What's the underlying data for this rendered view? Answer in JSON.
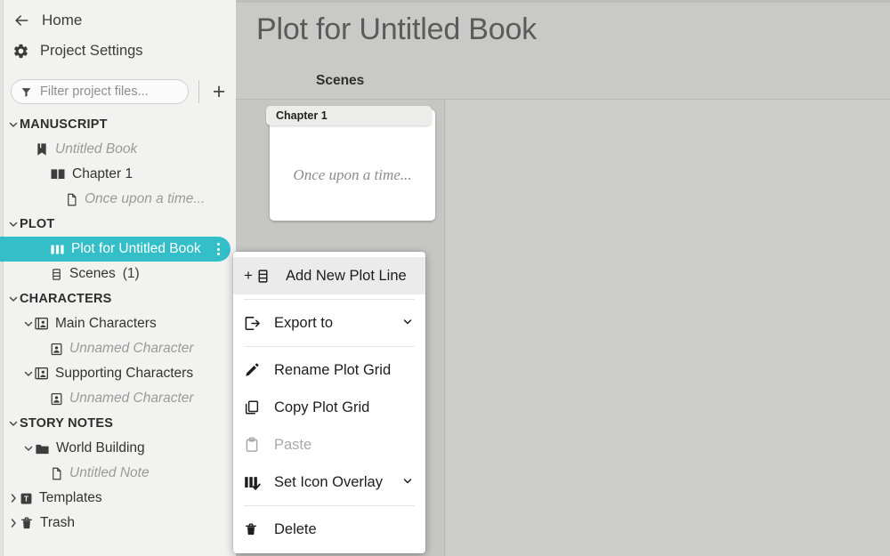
{
  "sidebar": {
    "home_label": "Home",
    "home_icon": "back-arrow-icon",
    "settings_label": "Project Settings",
    "settings_icon": "gear-icon",
    "filter_placeholder": "Filter project files...",
    "filter_value": "",
    "filter_icon": "funnel-icon",
    "add_label": "+",
    "tree": [
      {
        "label": "MANUSCRIPT",
        "type": "group",
        "indent": 0,
        "chevron": "down",
        "icon": null
      },
      {
        "label": "Untitled Book",
        "type": "item-muted",
        "indent": 1,
        "chevron": null,
        "icon": "book-bookmark-icon"
      },
      {
        "label": "Chapter 1",
        "type": "item",
        "indent": 2,
        "chevron": null,
        "icon": "open-book-icon"
      },
      {
        "label": "Once upon a time...",
        "type": "item-muted",
        "indent": 3,
        "chevron": null,
        "icon": "document-icon"
      },
      {
        "label": "PLOT",
        "type": "group",
        "indent": 0,
        "chevron": "down",
        "icon": null
      },
      {
        "label": "Plot for Untitled Book",
        "type": "item-selected",
        "indent": 2,
        "chevron": null,
        "icon": "plot-grid-icon"
      },
      {
        "label": "Scenes",
        "type": "item",
        "indent": 2,
        "chevron": null,
        "icon": "scenes-icon",
        "count": "(1)"
      },
      {
        "label": "CHARACTERS",
        "type": "group",
        "indent": 0,
        "chevron": "down",
        "icon": null
      },
      {
        "label": "Main Characters",
        "type": "item",
        "indent": 1,
        "chevron": "down",
        "icon": "character-stack-icon"
      },
      {
        "label": "Unnamed Character",
        "type": "item-muted",
        "indent": 2,
        "chevron": null,
        "icon": "character-icon"
      },
      {
        "label": "Supporting Characters",
        "type": "item",
        "indent": 1,
        "chevron": "down",
        "icon": "character-stack-icon"
      },
      {
        "label": "Unnamed Character",
        "type": "item-muted",
        "indent": 2,
        "chevron": null,
        "icon": "character-icon"
      },
      {
        "label": "STORY NOTES",
        "type": "group",
        "indent": 0,
        "chevron": "down",
        "icon": null
      },
      {
        "label": "World Building",
        "type": "item",
        "indent": 1,
        "chevron": "down",
        "icon": "folder-icon"
      },
      {
        "label": "Untitled Note",
        "type": "item-muted",
        "indent": 2,
        "chevron": null,
        "icon": "document-icon"
      },
      {
        "label": "Templates",
        "type": "item",
        "indent": 0,
        "chevron": "right",
        "icon": "template-icon"
      },
      {
        "label": "Trash",
        "type": "item",
        "indent": 0,
        "chevron": "right",
        "icon": "trash-icon"
      }
    ]
  },
  "main": {
    "title": "Plot for Untitled Book",
    "column_header": "Scenes",
    "cards": [
      {
        "tab_label": "Chapter 1",
        "body_text": "Once upon a time..."
      }
    ]
  },
  "context_menu": {
    "items": [
      {
        "label": "Add New Plot Line",
        "icon": "plot-line-icon",
        "prefix": "+",
        "state": "highlight",
        "caret": false
      },
      {
        "divider": true
      },
      {
        "label": "Export to",
        "icon": "export-icon",
        "state": "normal",
        "caret": true
      },
      {
        "divider": true
      },
      {
        "label": "Rename Plot Grid",
        "icon": "pencil-icon",
        "state": "normal",
        "caret": false
      },
      {
        "label": "Copy Plot Grid",
        "icon": "copy-icon",
        "state": "normal",
        "caret": false
      },
      {
        "label": "Paste",
        "icon": "clipboard-icon",
        "state": "disabled",
        "caret": false
      },
      {
        "label": "Set Icon Overlay",
        "icon": "icon-overlay-icon",
        "state": "normal",
        "caret": true
      },
      {
        "divider": true
      },
      {
        "label": "Delete",
        "icon": "trash-icon",
        "state": "normal",
        "caret": false
      }
    ]
  },
  "colors": {
    "accent_teal": "#33bec8",
    "sidebar_bg": "#f2f2f1",
    "main_bg": "#cdcdcb",
    "header_bg": "#c9c9c7",
    "scenes_col_bg": "#c6c6c4",
    "menu_bg": "#ffffff",
    "muted_text": "#9a9a9a"
  }
}
